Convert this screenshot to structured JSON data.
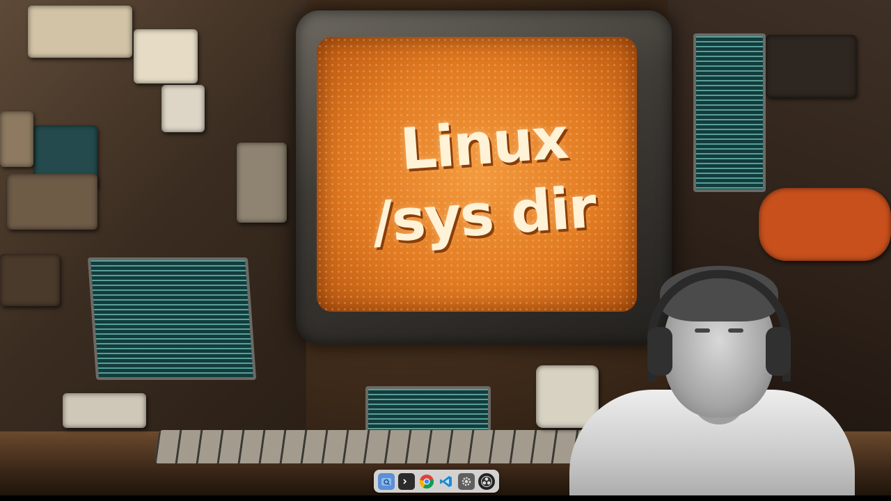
{
  "video_frame": {
    "screen_title_line1": "Linux",
    "screen_title_line2": "/sys dir"
  },
  "dock": {
    "items": [
      {
        "name": "file-manager",
        "icon": "folder-search-icon"
      },
      {
        "name": "terminal",
        "icon": "terminal-icon"
      },
      {
        "name": "chrome",
        "icon": "chrome-icon"
      },
      {
        "name": "vscode",
        "icon": "vscode-icon"
      },
      {
        "name": "settings",
        "icon": "gear-icon"
      },
      {
        "name": "obs",
        "icon": "obs-icon"
      }
    ]
  },
  "colors": {
    "screen_orange": "#e27b22",
    "title_text": "#fff2d6",
    "terminal_teal": "#123d3c",
    "dock_bg": "#ebebeb"
  }
}
